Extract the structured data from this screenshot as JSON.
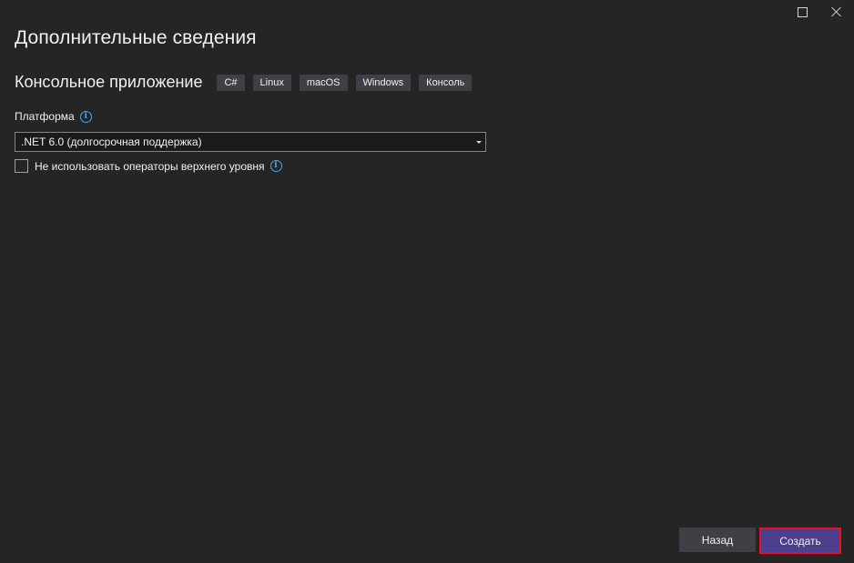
{
  "window": {
    "maximize_icon": "maximize-icon",
    "close_icon": "close-icon"
  },
  "header": {
    "title": "Дополнительные сведения"
  },
  "template": {
    "name": "Консольное приложение",
    "tags": [
      "C#",
      "Linux",
      "macOS",
      "Windows",
      "Консоль"
    ]
  },
  "platform": {
    "label": "Платформа",
    "info_icon": "info-icon",
    "selected": ".NET 6.0 (долгосрочная поддержка)"
  },
  "options": {
    "top_level_statements_label": "Не использовать операторы верхнего уровня",
    "top_level_statements_checked": false
  },
  "footer": {
    "back_label": "Назад",
    "create_label": "Создать"
  },
  "colors": {
    "background": "#252526",
    "tag_bg": "#3f3f46",
    "primary_button": "#4d3f8e",
    "highlight_border": "#e81123",
    "info_accent": "#4fa6e9"
  }
}
